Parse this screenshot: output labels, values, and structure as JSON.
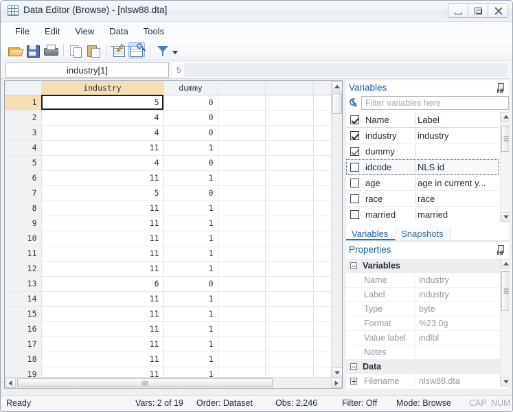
{
  "window": {
    "title": "Data Editor (Browse) - [nlsw88.dta]",
    "icon": "grid-icon",
    "minimize": "−",
    "maximize": "□",
    "close": "✕"
  },
  "menu": {
    "items": [
      {
        "label": "File"
      },
      {
        "label": "Edit"
      },
      {
        "label": "View"
      },
      {
        "label": "Data"
      },
      {
        "label": "Tools"
      }
    ]
  },
  "toolbar": {
    "buttons": [
      {
        "name": "open-icon",
        "tooltip": "Open"
      },
      {
        "name": "save-icon",
        "tooltip": "Save"
      },
      {
        "name": "print-icon",
        "tooltip": "Print"
      },
      {
        "name": "copy-icon",
        "tooltip": "Copy"
      },
      {
        "name": "paste-icon",
        "tooltip": "Paste"
      },
      {
        "name": "edit-mode-icon",
        "tooltip": "Edit mode"
      },
      {
        "name": "browse-mode-icon",
        "tooltip": "Browse mode",
        "active": true
      },
      {
        "name": "filter-icon",
        "tooltip": "Filter"
      }
    ]
  },
  "reference_bar": {
    "cell_reference": "industry[1]",
    "cell_value": "5"
  },
  "grid": {
    "columns": [
      "",
      "industry",
      "dummy",
      "",
      "",
      ""
    ],
    "selected_column": "industry",
    "active_cell": {
      "row": 1,
      "column": "industry",
      "value": "5"
    },
    "rows": [
      {
        "n": "1",
        "industry": "5",
        "dummy": "0"
      },
      {
        "n": "2",
        "industry": "4",
        "dummy": "0"
      },
      {
        "n": "3",
        "industry": "4",
        "dummy": "0"
      },
      {
        "n": "4",
        "industry": "11",
        "dummy": "1"
      },
      {
        "n": "5",
        "industry": "4",
        "dummy": "0"
      },
      {
        "n": "6",
        "industry": "11",
        "dummy": "1"
      },
      {
        "n": "7",
        "industry": "5",
        "dummy": "0"
      },
      {
        "n": "8",
        "industry": "11",
        "dummy": "1"
      },
      {
        "n": "9",
        "industry": "11",
        "dummy": "1"
      },
      {
        "n": "10",
        "industry": "11",
        "dummy": "1"
      },
      {
        "n": "11",
        "industry": "11",
        "dummy": "1"
      },
      {
        "n": "12",
        "industry": "11",
        "dummy": "1"
      },
      {
        "n": "13",
        "industry": "6",
        "dummy": "0"
      },
      {
        "n": "14",
        "industry": "11",
        "dummy": "1"
      },
      {
        "n": "15",
        "industry": "11",
        "dummy": "1"
      },
      {
        "n": "16",
        "industry": "11",
        "dummy": "1"
      },
      {
        "n": "17",
        "industry": "11",
        "dummy": "1"
      },
      {
        "n": "18",
        "industry": "11",
        "dummy": "1"
      },
      {
        "n": "19",
        "industry": "11",
        "dummy": "1"
      }
    ]
  },
  "variables_panel": {
    "title": "Variables",
    "filter_placeholder": "Filter variables here",
    "filter_value": "",
    "headers": {
      "name": "Name",
      "label": "Label"
    },
    "rows": [
      {
        "name": "industry",
        "label": "industry",
        "checked": true
      },
      {
        "name": "dummy",
        "label": "",
        "checked": true
      },
      {
        "name": "idcode",
        "label": "NLS id",
        "checked": false,
        "focused": true
      },
      {
        "name": "age",
        "label": "age in current y...",
        "checked": false
      },
      {
        "name": "race",
        "label": "race",
        "checked": false
      },
      {
        "name": "married",
        "label": "married",
        "checked": false
      }
    ]
  },
  "panel_tabs": [
    {
      "label": "Variables",
      "active": true
    },
    {
      "label": "Snapshots",
      "active": false
    }
  ],
  "properties_panel": {
    "title": "Properties",
    "groups": [
      {
        "name": "Variables",
        "expanded": true,
        "rows": [
          {
            "key": "Name",
            "value": "industry"
          },
          {
            "key": "Label",
            "value": "industry"
          },
          {
            "key": "Type",
            "value": "byte"
          },
          {
            "key": "Format",
            "value": "%23.0g"
          },
          {
            "key": "Value label",
            "value": "indlbl"
          },
          {
            "key": "Notes",
            "value": ""
          }
        ]
      },
      {
        "name": "Data",
        "expanded": true,
        "rows": [
          {
            "key": "Filename",
            "value": "nlsw88.dta",
            "expandable": true
          }
        ]
      }
    ]
  },
  "status_bar": {
    "ready": "Ready",
    "vars": "Vars: 2 of 19",
    "order": "Order: Dataset",
    "obs": "Obs: 2,246",
    "filter": "Filter: Off",
    "mode": "Mode: Browse",
    "cap": "CAP",
    "num": "NUM"
  },
  "colors": {
    "selected_header": "#f6dfb4",
    "accent_blue": "#1c5d99",
    "tab_underline": "#2b72b8"
  }
}
